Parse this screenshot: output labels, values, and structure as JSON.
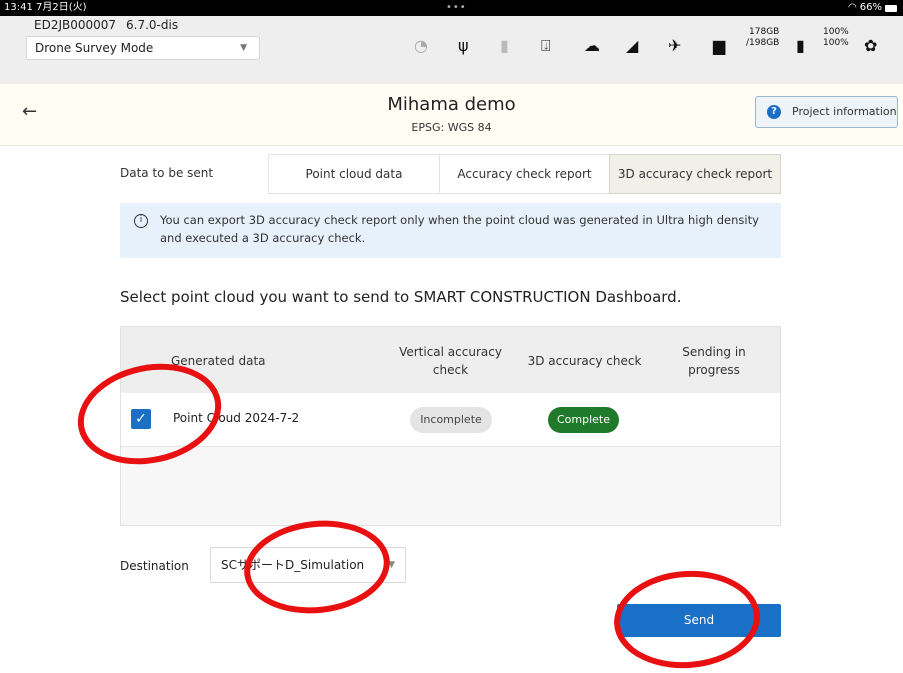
{
  "status_bar": {
    "time": "13:41 7月2日(火)",
    "dots": "•••",
    "wifi_battery": "66%"
  },
  "device": {
    "id": "ED2JB000007",
    "version": "6.7.0-dis",
    "mode": {
      "selected": "Drone Survey Mode"
    },
    "storage": {
      "used": "178GB",
      "total": "/198GB"
    },
    "levels": {
      "a": "100%",
      "b": "100%"
    },
    "icons": [
      "gauge-icon",
      "usb-icon",
      "sd-card-icon",
      "download-icon",
      "cloud-icon",
      "signal-icon",
      "satellite-icon",
      "folder-icon",
      "battery-icon",
      "gear-icon"
    ]
  },
  "project": {
    "title": "Mihama demo",
    "subtitle": "EPSG: WGS 84",
    "info_button": "Project information"
  },
  "tabs": {
    "label": "Data to be sent",
    "items": [
      "Point cloud data",
      "Accuracy check report",
      "3D accuracy check report"
    ],
    "active_index": 2
  },
  "notice": "You can export 3D accuracy check report only when the point cloud was generated in Ultra high density and executed a 3D accuracy check.",
  "select_title": "Select point cloud you want to send to SMART CONSTRUCTION Dashboard.",
  "table": {
    "headers": {
      "generated": "Generated data",
      "vertical": "Vertical accuracy check",
      "accuracy3d": "3D accuracy check",
      "sending": "Sending in progress"
    },
    "rows": [
      {
        "checked": true,
        "name": "Point Cloud 2024-7-2",
        "vertical": "Incomplete",
        "accuracy3d": "Complete",
        "sending": ""
      }
    ]
  },
  "destination": {
    "label": "Destination",
    "value": "SCサポートD_Simulation"
  },
  "send_label": "Send",
  "colors": {
    "accent": "#1a6fc6",
    "complete": "#1f7a2b",
    "annotation": "#e81010"
  }
}
